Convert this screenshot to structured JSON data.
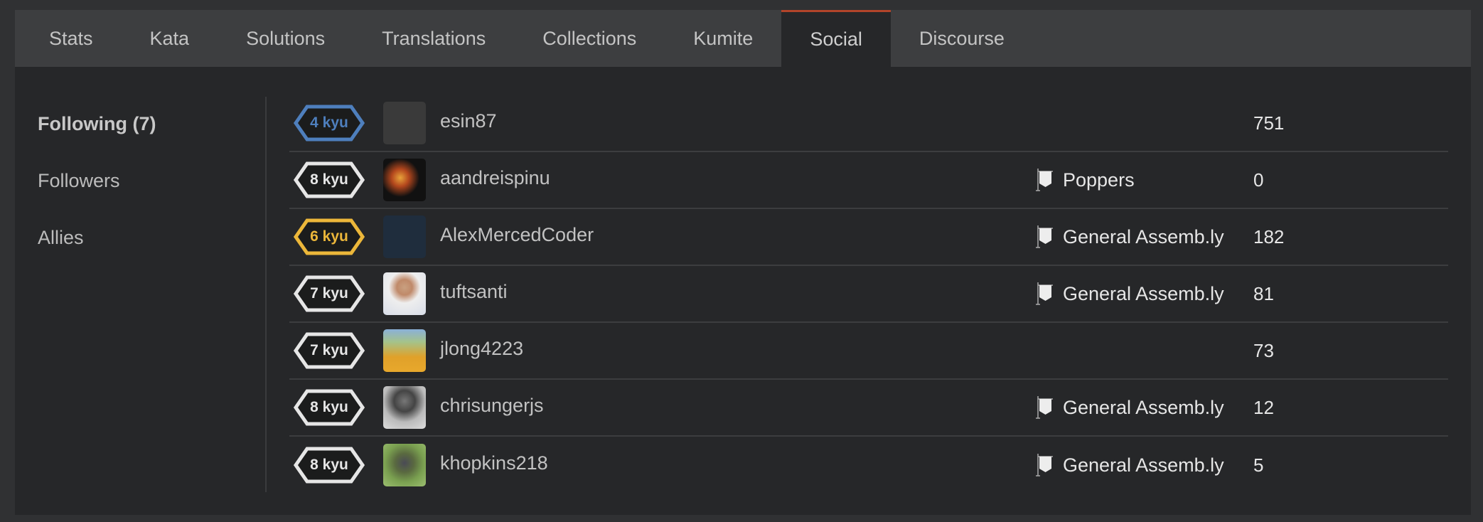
{
  "tabs": [
    {
      "label": "Stats",
      "active": false
    },
    {
      "label": "Kata",
      "active": false
    },
    {
      "label": "Solutions",
      "active": false
    },
    {
      "label": "Translations",
      "active": false
    },
    {
      "label": "Collections",
      "active": false
    },
    {
      "label": "Kumite",
      "active": false
    },
    {
      "label": "Social",
      "active": true
    },
    {
      "label": "Discourse",
      "active": false
    }
  ],
  "accent_color": "#b2442a",
  "sidebar": {
    "items": [
      {
        "label": "Following (7)",
        "active": true
      },
      {
        "label": "Followers",
        "active": false
      },
      {
        "label": "Allies",
        "active": false
      }
    ]
  },
  "rank_colors": {
    "4 kyu": "#4e7fbd",
    "6 kyu": "#ecb73a",
    "7 kyu": "#e6e6e6",
    "8 kyu": "#e6e6e6"
  },
  "users": [
    {
      "rank": "4 kyu",
      "username": "esin87",
      "clan": "",
      "honor": "751",
      "avatar": "bitmoji-avatar"
    },
    {
      "rank": "8 kyu",
      "username": "aandreispinu",
      "clan": "Poppers",
      "honor": "0",
      "avatar": "joker-avatar"
    },
    {
      "rank": "6 kyu",
      "username": "AlexMercedCoder",
      "clan": "General Assemb.ly",
      "honor": "182",
      "avatar": "cartoon-face-avatar"
    },
    {
      "rank": "7 kyu",
      "username": "tuftsanti",
      "clan": "General Assemb.ly",
      "honor": "81",
      "avatar": "photo-avatar"
    },
    {
      "rank": "7 kyu",
      "username": "jlong4223",
      "clan": "",
      "honor": "73",
      "avatar": "photo-avatar"
    },
    {
      "rank": "8 kyu",
      "username": "chrisungerjs",
      "clan": "General Assemb.ly",
      "honor": "12",
      "avatar": "photo-avatar"
    },
    {
      "rank": "8 kyu",
      "username": "khopkins218",
      "clan": "General Assemb.ly",
      "honor": "5",
      "avatar": "photo-avatar"
    }
  ]
}
